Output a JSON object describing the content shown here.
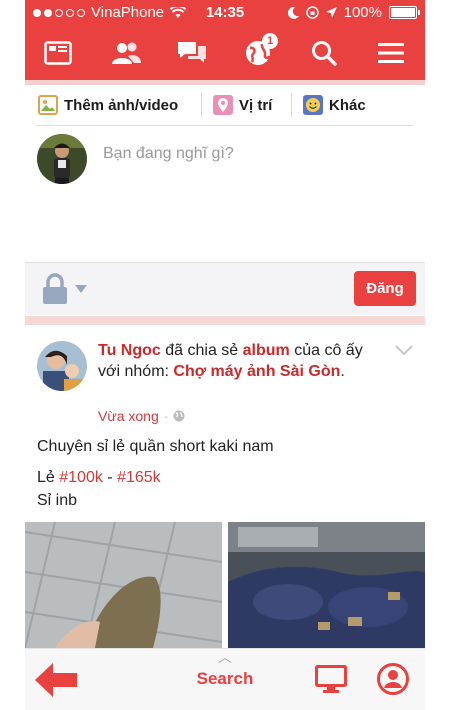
{
  "status": {
    "carrier": "VinaPhone",
    "time": "14:35",
    "battery": "100%"
  },
  "nav": {
    "notification_badge": "1"
  },
  "composer": {
    "add_media_label": "Thêm ảnh/video",
    "location_label": "Vị trí",
    "more_label": "Khác",
    "placeholder": "Bạn đang nghĩ gì?",
    "post_button": "Đăng"
  },
  "post": {
    "author": "Tu Ngoc",
    "shared_text": " đã chia sẻ ",
    "album_word": "album",
    "of_text": " của cô ấy với nhóm: ",
    "group": "Chợ máy ảnh Sài Gòn",
    "period": ".",
    "time": "Vừa xong",
    "line1": "Chuyên sỉ lẻ quần short kaki nam",
    "line2_prefix": "Lẻ ",
    "tag1": "#100k",
    "line2_mid": " - ",
    "tag2": "#165k",
    "line3": "Sỉ inb"
  },
  "bottom_bar": {
    "search_label": "Search"
  },
  "colors": {
    "accent": "#e94040",
    "accent_light": "#f6cfcf"
  }
}
